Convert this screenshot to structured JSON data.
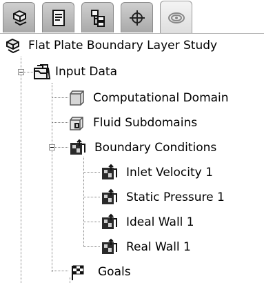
{
  "tabs": [
    {
      "name": "feature-manager-tab",
      "icon": "part-tree-icon",
      "active": false
    },
    {
      "name": "property-manager-tab",
      "icon": "property-sheet-icon",
      "active": false
    },
    {
      "name": "configuration-manager-tab",
      "icon": "configuration-icon",
      "active": false
    },
    {
      "name": "dimxpert-tab",
      "icon": "crosshair-icon",
      "active": false
    },
    {
      "name": "flow-analysis-tab",
      "icon": "flow-analysis-icon",
      "active": true
    }
  ],
  "tree": {
    "root": {
      "label": "Flat Plate Boundary Layer Study",
      "icon": "project-icon"
    },
    "input_data": {
      "label": "Input Data",
      "icon": "input-data-folder-icon",
      "expanded": true
    },
    "computational_domain": {
      "label": "Computational Domain",
      "icon": "computational-domain-icon"
    },
    "fluid_subdomains": {
      "label": "Fluid Subdomains",
      "icon": "fluid-subdomains-icon"
    },
    "boundary_conditions": {
      "label": "Boundary Conditions",
      "icon": "boundary-conditions-icon",
      "expanded": true
    },
    "conditions": [
      {
        "label": "Inlet Velocity 1",
        "icon": "boundary-condition-icon"
      },
      {
        "label": "Static Pressure 1",
        "icon": "boundary-condition-icon"
      },
      {
        "label": "Ideal Wall 1",
        "icon": "boundary-condition-icon"
      },
      {
        "label": "Real Wall 1",
        "icon": "boundary-condition-icon"
      }
    ],
    "goals": {
      "label": "Goals",
      "icon": "checkered-flag-icon"
    }
  }
}
